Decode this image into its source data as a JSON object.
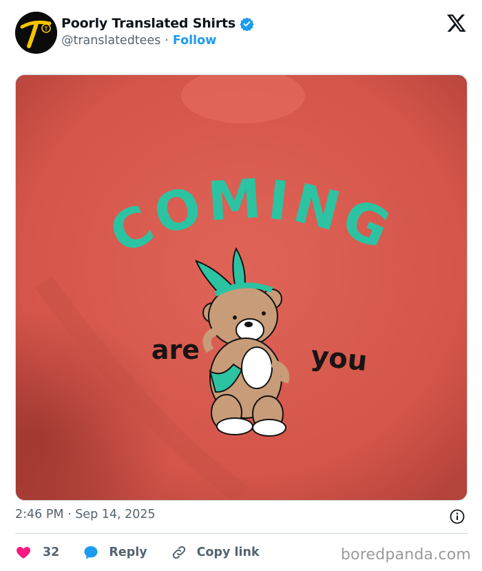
{
  "author": {
    "display_name": "Poorly Translated Shirts",
    "handle": "@translatedtees",
    "separator": "·",
    "follow_label": "Follow",
    "avatar_icon": "translatedtees-logo-icon",
    "verified_icon": "verified-badge-icon",
    "verified_color": "#1d9bf0"
  },
  "post": {
    "image_text": {
      "line1": "COMING",
      "left_word": "are",
      "right_word": "you"
    },
    "shirt_color": "#d95a4e",
    "print_color": "#2cc3a2",
    "timestamp": "2:46 PM · Sep 14, 2025"
  },
  "actions": {
    "like_count": "32",
    "like_icon": "heart-icon",
    "like_color": "#f91880",
    "reply_label": "Reply",
    "reply_icon": "speech-bubble-icon",
    "reply_color": "#1d9bf0",
    "copy_label": "Copy link",
    "copy_icon": "link-icon",
    "info_icon": "info-icon"
  },
  "brand": {
    "platform_icon": "x-logo-icon",
    "watermark": "boredpanda.com"
  }
}
